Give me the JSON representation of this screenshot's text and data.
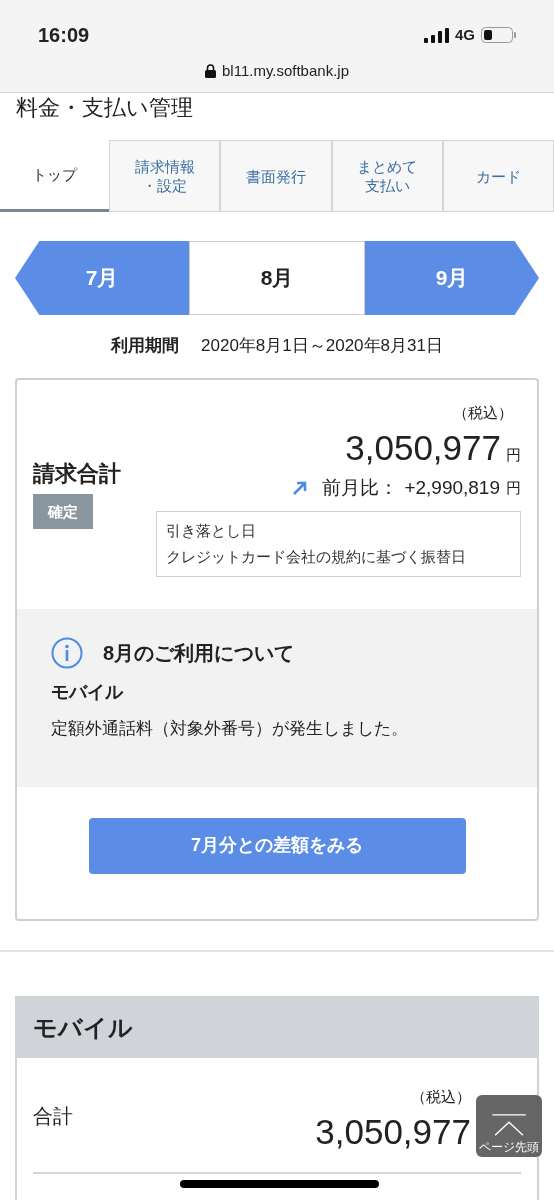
{
  "status_bar": {
    "time": "16:09",
    "network": "4G"
  },
  "browser": {
    "url": "bl11.my.softbank.jp"
  },
  "page_title": "料金・支払い管理",
  "tabs": [
    {
      "label": [
        "トップ"
      ],
      "selected": true
    },
    {
      "label": [
        "請求情報",
        "・設定"
      ],
      "selected": false
    },
    {
      "label": [
        "書面発行"
      ],
      "selected": false
    },
    {
      "label": [
        "まとめて",
        "支払い"
      ],
      "selected": false
    },
    {
      "label": [
        "カード"
      ],
      "selected": false
    }
  ],
  "months": [
    {
      "label": "7月",
      "selected": false
    },
    {
      "label": "8月",
      "selected": true
    },
    {
      "label": "9月",
      "selected": false
    }
  ],
  "period": {
    "label": "利用期間",
    "value": "2020年8月1日～2020年8月31日"
  },
  "billing": {
    "tax_note": "（税込）",
    "title": "請求合計",
    "status": "確定",
    "amount": "3,050,977",
    "currency": "円",
    "comparison_label": "前月比：",
    "comparison_value": "+2,990,819",
    "comparison_currency": "円",
    "debit_label": "引き落とし日",
    "debit_value": "クレジットカード会社の規約に基づく振替日"
  },
  "notice": {
    "title": "8月のご利用について",
    "category": "モバイル",
    "message": "定額外通話料（対象外番号）が発生しました。"
  },
  "diff_button": "7月分との差額をみる",
  "mobile": {
    "title": "モバイル",
    "tax_note": "（税込）",
    "total_label": "合計",
    "amount": "3,050,977"
  },
  "back_to_top": "ページ先頭"
}
